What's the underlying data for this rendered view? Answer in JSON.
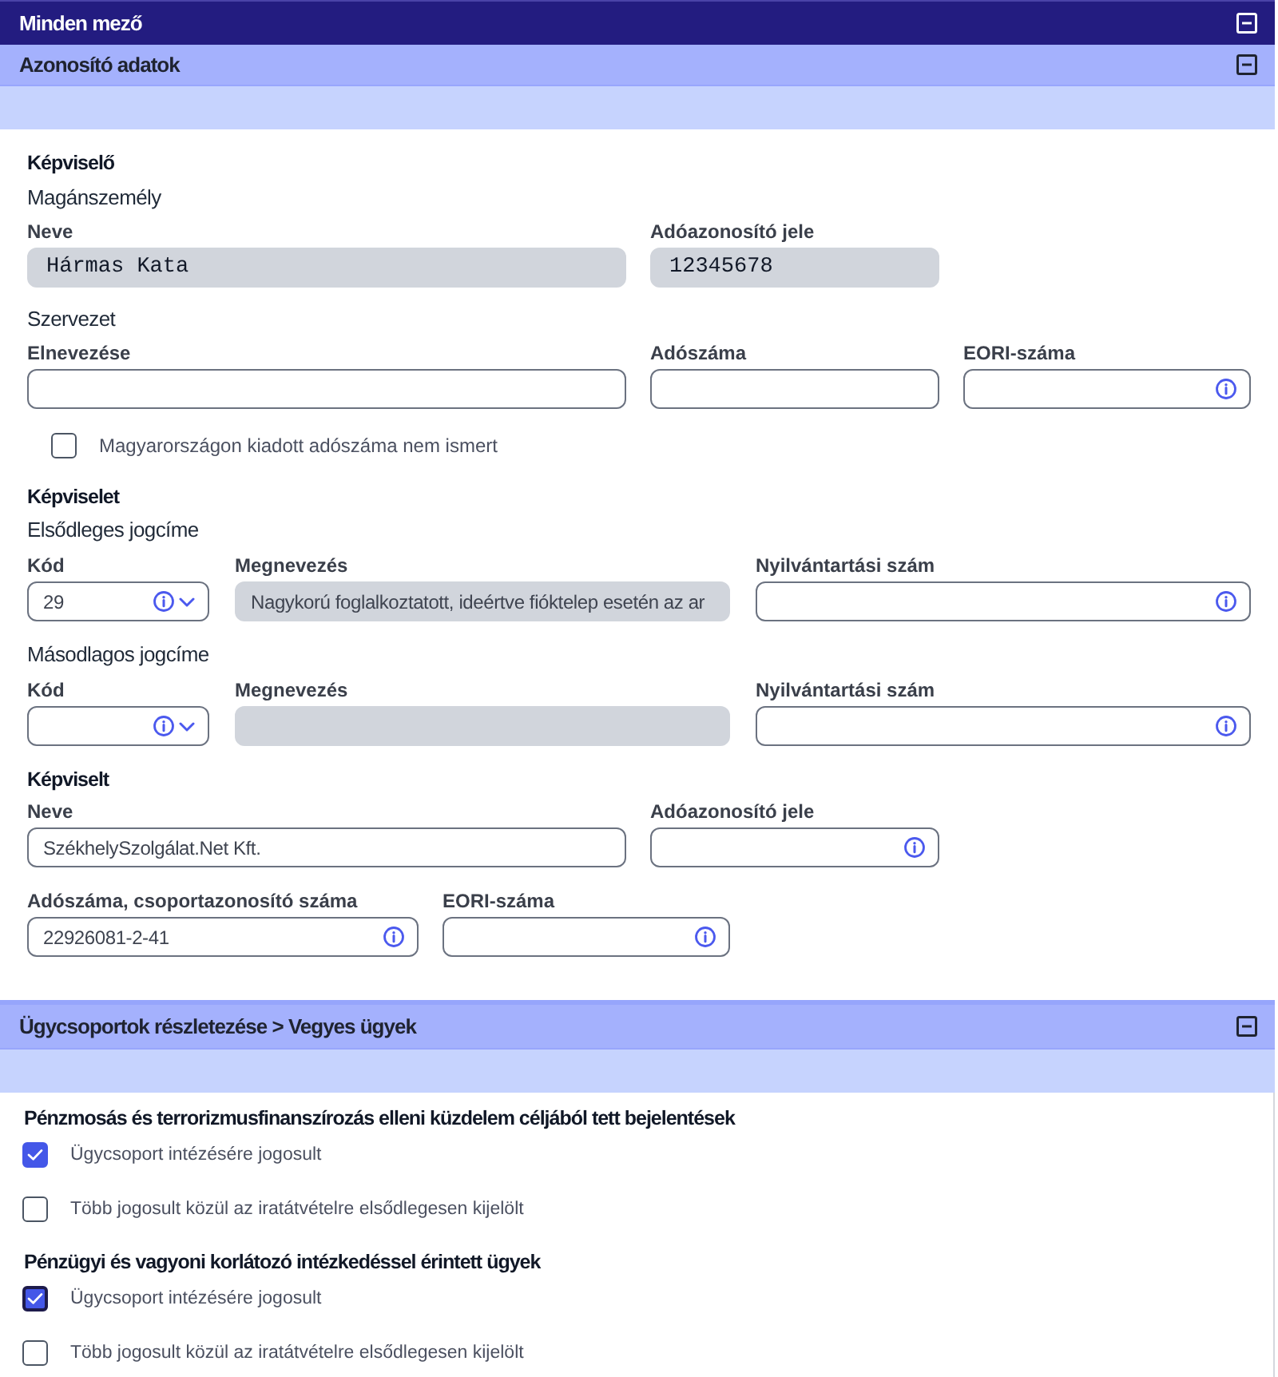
{
  "window": {
    "title": "Minden mező",
    "expanded": true
  },
  "identification": {
    "title": "Azonosító adatok",
    "expanded": true,
    "representative": {
      "heading": "Képviselő",
      "private_person": {
        "heading": "Magánszemély",
        "name": {
          "label": "Neve",
          "value": "Hármas Kata",
          "readonly": true,
          "info": false
        },
        "tax_id": {
          "label": "Adóazonosító jele",
          "value": "12345678",
          "readonly": true,
          "info": false
        }
      },
      "organization": {
        "heading": "Szervezet",
        "name": {
          "label": "Elnevezése",
          "readonly": false,
          "info": false
        },
        "tax_number": {
          "label": "Adószáma",
          "readonly": false,
          "info": false
        },
        "eori": {
          "label": "EORI-száma",
          "readonly": false,
          "info": true
        }
      },
      "no_hungarian_tax_number": {
        "label": "Magyarországon kiadott adószáma nem ismert",
        "checked": false
      }
    },
    "representation": {
      "heading": "Képviselet",
      "legal_titles": [
        {
          "heading": "Elsődleges jogcíme",
          "code": {
            "label": "Kód",
            "value": "29",
            "readonly": false,
            "info": true
          },
          "description": {
            "label": "Megnevezés",
            "value": "Nagykorú foglalkoztatott, ideértve fióktelep esetén az ar",
            "readonly": true,
            "info": false
          },
          "registration_number": {
            "label": "Nyilvántartási szám",
            "readonly": false,
            "info": true
          }
        },
        {
          "heading": "Másodlagos jogcíme",
          "code": {
            "label": "Kód",
            "readonly": false,
            "info": true
          },
          "description": {
            "label": "Megnevezés",
            "readonly": true,
            "info": false
          },
          "registration_number": {
            "label": "Nyilvántartási szám",
            "readonly": false,
            "info": true
          }
        }
      ]
    },
    "represented": {
      "heading": "Képviselt",
      "name": {
        "label": "Neve",
        "value": "SzékhelySzolgálat.Net Kft.",
        "readonly": false,
        "info": false
      },
      "tax_id": {
        "label": "Adóazonosító jele",
        "readonly": false,
        "info": true
      },
      "tax_number": {
        "label": "Adószáma, csoportazonosító száma",
        "value": "22926081-2-41",
        "readonly": false,
        "info": true
      },
      "eori": {
        "label": "EORI-száma",
        "readonly": false,
        "info": true
      }
    }
  },
  "case_groups": {
    "title": "Ügycsoportok részletezése > Vegyes ügyek",
    "expanded": true,
    "groups": [
      {
        "heading": "Pénzmosás és terrorizmusfinanszírozás elleni küzdelem céljából tett bejelentések",
        "options": [
          {
            "label": "Ügycsoport intézésére jogosult",
            "checked": true,
            "focused": false
          },
          {
            "label": "Több jogosult közül az iratátvételre elsődlegesen kijelölt",
            "checked": false,
            "focused": false
          }
        ]
      },
      {
        "heading": "Pénzügyi és vagyoni korlátozó intézkedéssel érintett ügyek",
        "options": [
          {
            "label": "Ügycsoport intézésére jogosult",
            "checked": true,
            "focused": true
          },
          {
            "label": "Több jogosult közül az iratátvételre elsődlegesen kijelölt",
            "checked": false,
            "focused": false
          }
        ]
      }
    ]
  }
}
